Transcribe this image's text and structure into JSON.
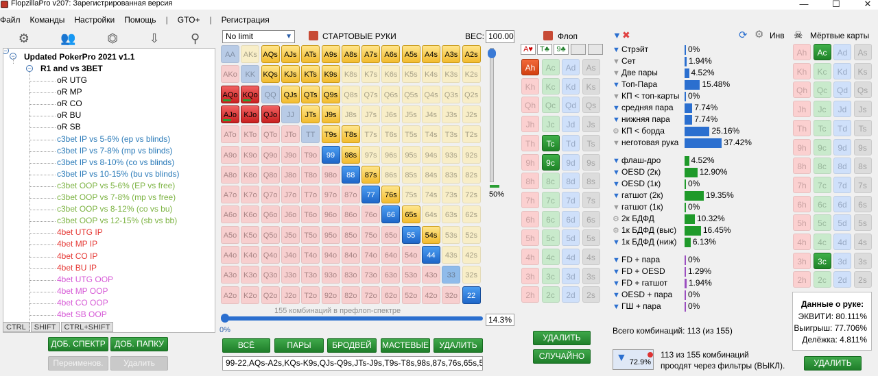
{
  "app": {
    "title": "FlopzillaPro v207: Зарегистрированная версия",
    "icon": "app-logo-icon"
  },
  "window_controls": {
    "minimize": "—",
    "maximize": "☐",
    "close": "✕"
  },
  "menu": {
    "items": [
      "Файл",
      "Команды",
      "Настройки",
      "Помощь",
      "GTO+",
      "Регистрация"
    ],
    "separator": "|"
  },
  "left_toolbar": {
    "icons": [
      "gear-icon",
      "users-icon",
      "filter-plus-icon",
      "import-icon",
      "search-icon"
    ],
    "glyphs": [
      "⚙",
      "👥",
      "⏣",
      "⇩",
      "⚲"
    ]
  },
  "tree": {
    "toggle": "−",
    "root": "Updated PokerPro 2021 v1.1",
    "group": "R1 and vs 3BET",
    "items": [
      {
        "label": "oR UTG",
        "color": "#000000"
      },
      {
        "label": "oR MP",
        "color": "#000000"
      },
      {
        "label": "oR CO",
        "color": "#000000"
      },
      {
        "label": "oR BU",
        "color": "#000000"
      },
      {
        "label": "oR SB",
        "color": "#000000"
      },
      {
        "label": "c3bet IP vs 5-6% (ep vs blinds)",
        "color": "#2a7ab8"
      },
      {
        "label": "c3bet IP vs 7-8% (mp vs blinds)",
        "color": "#2a7ab8"
      },
      {
        "label": "c3bet IP vs 8-10% (co vs blinds)",
        "color": "#2a7ab8"
      },
      {
        "label": "c3bet IP vs 10-15% (bu vs blinds)",
        "color": "#2a7ab8"
      },
      {
        "label": "c3bet OOP vs 5-6% (EP vs free)",
        "color": "#7cb342"
      },
      {
        "label": "c3bet OOP vs 7-8% (mp vs free)",
        "color": "#7cb342"
      },
      {
        "label": "c3bet OOP vs 8-12% (co vs bu)",
        "color": "#7cb342"
      },
      {
        "label": "c3bet OOP vs 12-15% (sb vs bb)",
        "color": "#7cb342"
      },
      {
        "label": "4bet UTG IP",
        "color": "#e53935"
      },
      {
        "label": "4bet MP IP",
        "color": "#e53935"
      },
      {
        "label": "4bet CO IP",
        "color": "#e53935"
      },
      {
        "label": "4bet BU IP",
        "color": "#e53935"
      },
      {
        "label": "4bet UTG OOP",
        "color": "#d65ad6"
      },
      {
        "label": "4bet MP OOP",
        "color": "#d65ad6"
      },
      {
        "label": "4bet CO OOP",
        "color": "#d65ad6"
      },
      {
        "label": "4bet SB OOP",
        "color": "#d65ad6"
      }
    ]
  },
  "kbd": [
    "CTRL",
    "SHIFT",
    "CTRL+SHIFT"
  ],
  "left_buttons": {
    "add_spectrum": "ДОБ. СПЕКТР",
    "add_folder": "ДОБ. ПАПКУ",
    "rename": "Переименов.",
    "delete": "Удалить"
  },
  "limit": {
    "value": "No limit",
    "arrow": "▼"
  },
  "start_hands_title": "СТАРТОВЫЕ РУКИ",
  "weight": {
    "label": "ВЕС:",
    "value": "100.00"
  },
  "ranks": [
    "A",
    "K",
    "Q",
    "J",
    "T",
    "9",
    "8",
    "7",
    "6",
    "5",
    "4",
    "3",
    "2"
  ],
  "selected_hands": [
    "AQs",
    "AJs",
    "ATs",
    "A9s",
    "A8s",
    "A7s",
    "A6s",
    "A5s",
    "A4s",
    "A3s",
    "A2s",
    "KQs",
    "KJs",
    "KTs",
    "K9s",
    "AQo",
    "KQo",
    "QJs",
    "QTs",
    "Q9s",
    "AJo",
    "KJo",
    "QJo",
    "JTs",
    "J9s",
    "T9s",
    "T8s",
    "99",
    "98s",
    "88",
    "87s",
    "77",
    "76s",
    "66",
    "65s",
    "55",
    "54s",
    "44",
    "33",
    "22"
  ],
  "green_marked_hands": [
    "AQo",
    "KQo",
    "AJo"
  ],
  "light_blue_hands": [
    "33"
  ],
  "matrix_slider": {
    "percent": "50%"
  },
  "prefllop_combos": "155 комбинаций в префлоп-спектре",
  "range_percent": "14.3%",
  "range_min": "0%",
  "range_buttons": {
    "all": "ВСЁ",
    "pairs": "ПАРЫ",
    "broadway": "БРОДВЕЙ",
    "suited": "МАСТЕВЫЕ",
    "delete": "УДАЛИТЬ"
  },
  "range_text": "99-22,AQs-A2s,KQs-K9s,QJs-Q9s,JTs-J9s,T9s-T8s,98s,87s,76s,65s,54s",
  "flop": {
    "title": "Флоп",
    "slots": [
      "A♥",
      "T♣",
      "9♣",
      "",
      ""
    ],
    "selected": [
      "Ah",
      "Tc",
      "9c"
    ],
    "delete": "УДАЛИТЬ",
    "random": "СЛУЧАЙНО"
  },
  "suits": [
    "h",
    "c",
    "d",
    "s"
  ],
  "filters": {
    "icon": "filter-icon",
    "clear_icon": "✖",
    "rows": [
      {
        "label": "Стрэйт",
        "value": "0%",
        "pct": 0,
        "active": true,
        "color": "#2b6fcf",
        "icon": "▼"
      },
      {
        "label": "Сет",
        "value": "1.94%",
        "pct": 1.94,
        "active": false,
        "color": "#2b6fcf",
        "icon": "▼"
      },
      {
        "label": "Две пары",
        "value": "4.52%",
        "pct": 4.52,
        "active": false,
        "color": "#2b6fcf",
        "icon": "▼"
      },
      {
        "label": "Топ-Пара",
        "value": "15.48%",
        "pct": 15.48,
        "active": true,
        "color": "#2b6fcf",
        "icon": "▼"
      },
      {
        "label": "КП < топ-карты",
        "value": "0%",
        "pct": 0,
        "active": false,
        "color": "#2b6fcf",
        "icon": "▼"
      },
      {
        "label": "средняя пара",
        "value": "7.74%",
        "pct": 7.74,
        "active": true,
        "color": "#2b6fcf",
        "icon": "▼"
      },
      {
        "label": "нижняя пара",
        "value": "7.74%",
        "pct": 7.74,
        "active": true,
        "color": "#2b6fcf",
        "icon": "▼"
      },
      {
        "label": "КП < борда",
        "value": "25.16%",
        "pct": 25.16,
        "active": false,
        "color": "#2b6fcf",
        "icon": "⚙"
      },
      {
        "label": "неготовая рука",
        "value": "37.42%",
        "pct": 37.42,
        "active": false,
        "color": "#2b6fcf",
        "icon": "▼"
      },
      {
        "label": "флаш-дро",
        "value": "4.52%",
        "pct": 4.52,
        "active": true,
        "color": "#1f9a2a",
        "icon": "▼"
      },
      {
        "label": "OESD (2к)",
        "value": "12.90%",
        "pct": 12.9,
        "active": true,
        "color": "#1f9a2a",
        "icon": "▼"
      },
      {
        "label": "OESD (1к)",
        "value": "0%",
        "pct": 0,
        "active": true,
        "color": "#1f9a2a",
        "icon": "▼"
      },
      {
        "label": "гатшот (2к)",
        "value": "19.35%",
        "pct": 19.35,
        "active": true,
        "color": "#1f9a2a",
        "icon": "▼"
      },
      {
        "label": "гатшот (1к)",
        "value": "0%",
        "pct": 0,
        "active": false,
        "color": "#1f9a2a",
        "icon": "▼"
      },
      {
        "label": "2к БДФД",
        "value": "10.32%",
        "pct": 10.32,
        "active": false,
        "color": "#1f9a2a",
        "icon": "⚙"
      },
      {
        "label": "1к БДФД (выс)",
        "value": "16.45%",
        "pct": 16.45,
        "active": false,
        "color": "#1f9a2a",
        "icon": "⚙"
      },
      {
        "label": "1к БДФД (ниж)",
        "value": "6.13%",
        "pct": 6.13,
        "active": true,
        "color": "#1f9a2a",
        "icon": "▼"
      },
      {
        "label": "FD + пара",
        "value": "0%",
        "pct": 0,
        "active": true,
        "color": "#9b4ec0",
        "icon": "▼"
      },
      {
        "label": "FD + OESD",
        "value": "1.29%",
        "pct": 1.29,
        "active": true,
        "color": "#9b4ec0",
        "icon": "▼"
      },
      {
        "label": "FD + гатшот",
        "value": "1.94%",
        "pct": 1.94,
        "active": true,
        "color": "#9b4ec0",
        "icon": "▼"
      },
      {
        "label": "OESD + пара",
        "value": "0%",
        "pct": 0,
        "active": true,
        "color": "#9b4ec0",
        "icon": "▼"
      },
      {
        "label": "ГШ + пара",
        "value": "0%",
        "pct": 0,
        "active": true,
        "color": "#9b4ec0",
        "icon": "▼"
      }
    ]
  },
  "total_combos": "Всего комбинаций: 113 (из 155)",
  "filter_box": {
    "value": "72.9%"
  },
  "pass_text_1": "113 из 155 комбинаций",
  "pass_text_2": "проодят через фильтры (ВЫКЛ).",
  "inv": {
    "label": "Инв"
  },
  "dead_cards": {
    "title": "Мёртвые карты",
    "selected": [
      "Ac",
      "3c"
    ],
    "delete": "УДАЛИТЬ"
  },
  "hand_info": {
    "title": "Данные о руке:",
    "equity": "ЭКВИТИ: 80.111%",
    "wins": "Выигрыш: 77.706%",
    "split": "Делёжка: 4.811%"
  }
}
